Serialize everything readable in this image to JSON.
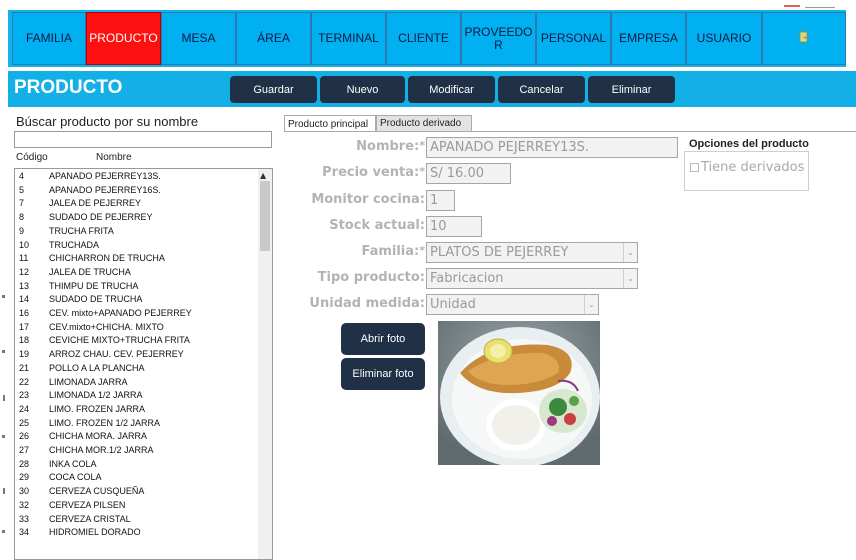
{
  "nav": {
    "items": [
      "FAMILIA",
      "PRODUCTO",
      "MESA",
      "ÁREA",
      "TERMINAL",
      "CLIENTE",
      "PROVEEDOR",
      "PERSONAL",
      "EMPRESA",
      "USUARIO"
    ],
    "active": "PRODUCTO",
    "exit_icon": "exit-door-icon"
  },
  "header": {
    "title": "PRODUCTO",
    "buttons": [
      "Guardar",
      "Nuevo",
      "Modificar",
      "Cancelar",
      "Eliminar"
    ]
  },
  "search": {
    "label": "Búscar producto por su nombre",
    "value": ""
  },
  "list": {
    "headers": {
      "code": "Código",
      "name": "Nombre"
    },
    "rows": [
      {
        "code": "4",
        "name": "APANADO PEJERREY13S."
      },
      {
        "code": "5",
        "name": "APANADO PEJERREY16S."
      },
      {
        "code": "7",
        "name": "JALEA DE PEJERREY"
      },
      {
        "code": "8",
        "name": "SUDADO DE PEJERREY"
      },
      {
        "code": "9",
        "name": "TRUCHA FRITA"
      },
      {
        "code": "10",
        "name": "TRUCHADA"
      },
      {
        "code": "11",
        "name": "CHICHARRON DE TRUCHA"
      },
      {
        "code": "12",
        "name": "JALEA DE TRUCHA"
      },
      {
        "code": "13",
        "name": "THIMPU DE TRUCHA"
      },
      {
        "code": "14",
        "name": "SUDADO DE TRUCHA"
      },
      {
        "code": "16",
        "name": "CEV. mixto+APANADO PEJERREY"
      },
      {
        "code": "17",
        "name": "CEV.mixto+CHICHA. MIXTO"
      },
      {
        "code": "18",
        "name": "CEVICHE MIXTO+TRUCHA FRITA"
      },
      {
        "code": "19",
        "name": "ARROZ CHAU. CEV. PEJERREY"
      },
      {
        "code": "21",
        "name": "POLLO A LA PLANCHA"
      },
      {
        "code": "22",
        "name": "LIMONADA JARRA"
      },
      {
        "code": "23",
        "name": "LIMONADA 1/2 JARRA"
      },
      {
        "code": "24",
        "name": "LIMO. FROZEN JARRA"
      },
      {
        "code": "25",
        "name": "LIMO. FROZEN 1/2 JARRA"
      },
      {
        "code": "26",
        "name": "CHICHA MORA. JARRA"
      },
      {
        "code": "27",
        "name": "CHICHA MOR.1/2 JARRA"
      },
      {
        "code": "28",
        "name": "INKA COLA"
      },
      {
        "code": "29",
        "name": "COCA COLA"
      },
      {
        "code": "30",
        "name": "CERVEZA CUSQUEÑA"
      },
      {
        "code": "32",
        "name": "CERVEZA PILSEN"
      },
      {
        "code": "33",
        "name": "CERVEZA CRISTAL"
      },
      {
        "code": "34",
        "name": "HIDROMIEL DORADO"
      }
    ]
  },
  "tabs": [
    "Producto principal",
    "Producto derivado"
  ],
  "form": {
    "nombre_label": "Nombre:",
    "nombre_value": "APANADO PEJERREY13S.",
    "precio_label": "Precio venta:",
    "precio_value": "S/ 16.00",
    "monitor_label": "Monitor cocina:",
    "monitor_value": "1",
    "stock_label": "Stock actual:",
    "stock_value": "10",
    "familia_label": "Familia:",
    "familia_value": "PLATOS DE PEJERREY",
    "tipo_label": "Tipo producto:",
    "tipo_value": "Fabricacion",
    "unidad_label": "Unidad medida:",
    "unidad_value": "Unidad",
    "required_mark": "*"
  },
  "options": {
    "title": "Opciones del producto",
    "tiene_derivados": "Tiene derivados",
    "tiene_derivados_checked": false
  },
  "photo": {
    "open_label": "Abrir foto",
    "delete_label": "Eliminar foto"
  },
  "colors": {
    "nav_bg": "#00b0f0",
    "nav_active": "#ff1010",
    "header_bg": "#12b0e6",
    "button_dark": "#1f3047"
  }
}
